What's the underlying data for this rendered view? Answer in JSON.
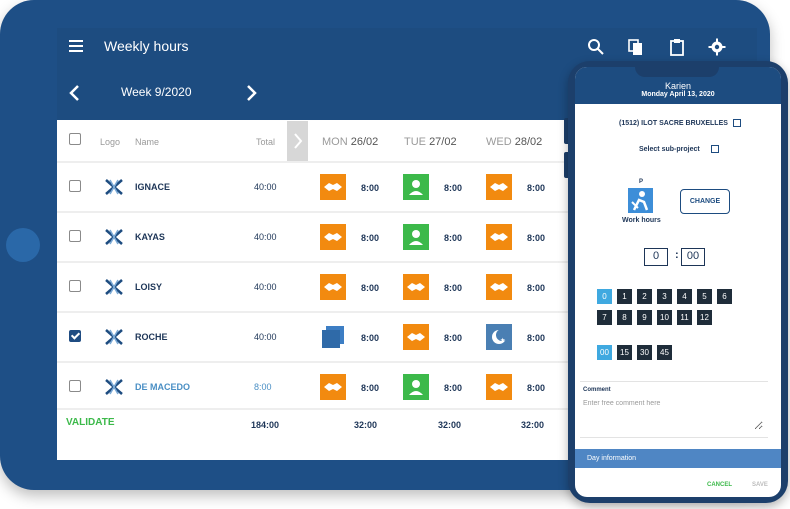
{
  "app": {
    "title": "Weekly hours",
    "week_label": "Week 9/2020",
    "icons": [
      "menu-icon",
      "search-icon",
      "copy-icon",
      "clipboard-icon",
      "gear-icon"
    ]
  },
  "table": {
    "headers": {
      "logo": "Logo",
      "name": "Name",
      "total": "Total"
    },
    "days": [
      {
        "dow": "MON",
        "date": "26/02"
      },
      {
        "dow": "TUE",
        "date": "27/02"
      },
      {
        "dow": "WED",
        "date": "28/02"
      }
    ],
    "rows": [
      {
        "name": "IGNACE",
        "total": "40:00",
        "checked": false,
        "cells": [
          {
            "icon": "handshake-icon",
            "hours": "8:00"
          },
          {
            "icon": "person-icon",
            "hours": "8:00"
          },
          {
            "icon": "handshake-icon",
            "hours": "8:00"
          }
        ]
      },
      {
        "name": "KAYAS",
        "total": "40:00",
        "checked": false,
        "cells": [
          {
            "icon": "handshake-icon",
            "hours": "8:00"
          },
          {
            "icon": "person-icon",
            "hours": "8:00"
          },
          {
            "icon": "handshake-icon",
            "hours": "8:00"
          }
        ]
      },
      {
        "name": "LOISY",
        "total": "40:00",
        "checked": false,
        "cells": [
          {
            "icon": "handshake-icon",
            "hours": "8:00"
          },
          {
            "icon": "handshake-icon",
            "hours": "8:00"
          },
          {
            "icon": "handshake-icon",
            "hours": "8:00"
          }
        ]
      },
      {
        "name": "ROCHE",
        "total": "40:00",
        "checked": true,
        "cells": [
          {
            "icon": "blue-square-icon",
            "hours": "8:00"
          },
          {
            "icon": "handshake-icon",
            "hours": "8:00"
          },
          {
            "icon": "moon-icon",
            "hours": "8:00"
          }
        ]
      },
      {
        "name": "DE MACEDO",
        "total": "8:00",
        "checked": false,
        "cells": [
          {
            "icon": "handshake-icon",
            "hours": "8:00"
          },
          {
            "icon": "person-icon",
            "hours": "8:00"
          },
          {
            "icon": "handshake-icon",
            "hours": "8:00"
          }
        ]
      }
    ],
    "validate_label": "VALIDATE",
    "footer_total": "184:00",
    "footer_days": [
      "32:00",
      "32:00",
      "32:00"
    ]
  },
  "colors": {
    "primary": "#1d4c80",
    "orange": "#f28a0f",
    "green": "#3cb94a",
    "light_blue": "#4a8fc4",
    "highlight": "#3fa9e0"
  },
  "phone": {
    "user": "Karien",
    "date": "Monday April 13, 2020",
    "project": "(1512) ILOT SACRE BRUXELLES",
    "subproject": "Select sub-project",
    "activity_letter": "P",
    "activity_label": "Work hours",
    "change_label": "CHANGE",
    "time_hours": "0",
    "time_minutes": "00",
    "hour_buttons": [
      "0",
      "1",
      "2",
      "3",
      "4",
      "5",
      "6",
      "7",
      "8",
      "9",
      "10",
      "11",
      "12"
    ],
    "selected_hour": "0",
    "minute_buttons": [
      "00",
      "15",
      "30",
      "45"
    ],
    "selected_minute": "00",
    "comment_label": "Comment",
    "comment_placeholder": "Enter free comment here",
    "day_info_label": "Day information",
    "cancel_label": "CANCEL",
    "save_label": "SAVE"
  }
}
